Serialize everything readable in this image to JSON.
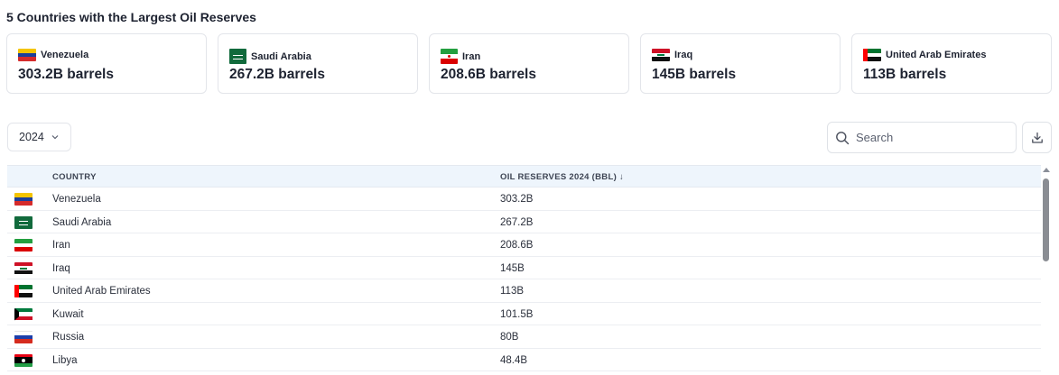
{
  "page": {
    "title": "5 Countries with the Largest Oil Reserves"
  },
  "cards": [
    {
      "name": "Venezuela",
      "value": "303.2B barrels",
      "flag": "venezuela-flag"
    },
    {
      "name": "Saudi Arabia",
      "value": "267.2B barrels",
      "flag": "saudi-arabia-flag"
    },
    {
      "name": "Iran",
      "value": "208.6B barrels",
      "flag": "iran-flag"
    },
    {
      "name": "Iraq",
      "value": "145B barrels",
      "flag": "iraq-flag"
    },
    {
      "name": "United Arab Emirates",
      "value": "113B barrels",
      "flag": "uae-flag"
    }
  ],
  "toolbar": {
    "year": "2024",
    "search_placeholder": "Search",
    "icons": {
      "chevron": "chevron-down-icon",
      "search": "search-icon",
      "download": "download-icon"
    }
  },
  "table": {
    "headers": {
      "country": "COUNTRY",
      "reserves": "OIL RESERVES 2024 (BBL) ↓"
    },
    "rows": [
      {
        "country": "Venezuela",
        "value": "303.2B",
        "flag": "venezuela-flag"
      },
      {
        "country": "Saudi Arabia",
        "value": "267.2B",
        "flag": "saudi-arabia-flag"
      },
      {
        "country": "Iran",
        "value": "208.6B",
        "flag": "iran-flag"
      },
      {
        "country": "Iraq",
        "value": "145B",
        "flag": "iraq-flag"
      },
      {
        "country": "United Arab Emirates",
        "value": "113B",
        "flag": "uae-flag"
      },
      {
        "country": "Kuwait",
        "value": "101.5B",
        "flag": "kuwait-flag"
      },
      {
        "country": "Russia",
        "value": "80B",
        "flag": "russia-flag"
      },
      {
        "country": "Libya",
        "value": "48.4B",
        "flag": "libya-flag"
      }
    ]
  },
  "colors": {
    "header_bg": "#eef5fc",
    "border": "#e3e5ea",
    "text": "#1d2230"
  }
}
